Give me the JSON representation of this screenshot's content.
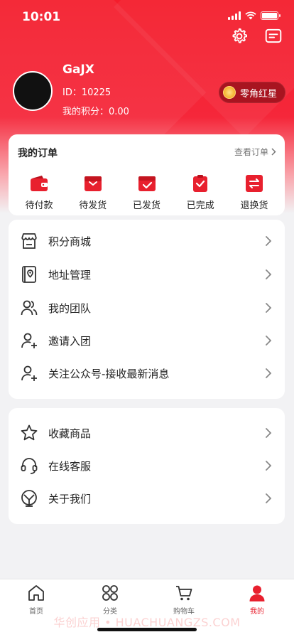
{
  "status": {
    "time": "10:01"
  },
  "profile": {
    "name": "GaJX",
    "id": "ID：10225",
    "points": "我的积分：0.00"
  },
  "badge": {
    "label": "零角红星"
  },
  "orders": {
    "title": "我的订单",
    "view_all": "查看订单",
    "items": [
      {
        "label": "待付款",
        "icon": "wallet-icon"
      },
      {
        "label": "待发货",
        "icon": "package-icon"
      },
      {
        "label": "已发货",
        "icon": "shipped-box-icon"
      },
      {
        "label": "已完成",
        "icon": "clipboard-check-icon"
      },
      {
        "label": "退换货",
        "icon": "exchange-icon"
      }
    ]
  },
  "menu1": [
    {
      "label": "积分商城",
      "icon": "store-icon"
    },
    {
      "label": "地址管理",
      "icon": "address-book-icon"
    },
    {
      "label": "我的团队",
      "icon": "team-icon"
    },
    {
      "label": "邀请入团",
      "icon": "add-user-icon"
    },
    {
      "label": "关注公众号-接收最新消息",
      "icon": "add-user-icon"
    }
  ],
  "menu2": [
    {
      "label": "收藏商品",
      "icon": "star-icon"
    },
    {
      "label": "在线客服",
      "icon": "headset-icon"
    },
    {
      "label": "关于我们",
      "icon": "about-icon"
    }
  ],
  "tabs": [
    {
      "label": "首页",
      "icon": "home-icon"
    },
    {
      "label": "分类",
      "icon": "category-icon"
    },
    {
      "label": "购物车",
      "icon": "cart-icon"
    },
    {
      "label": "我的",
      "icon": "user-icon",
      "active": true
    }
  ],
  "watermark": "华创应用 • HUACHUANGZS.COM",
  "colors": {
    "accent": "#e8202e",
    "hero": "#f41d2c",
    "badge": "#a81420",
    "background": "#f2f2f4"
  }
}
